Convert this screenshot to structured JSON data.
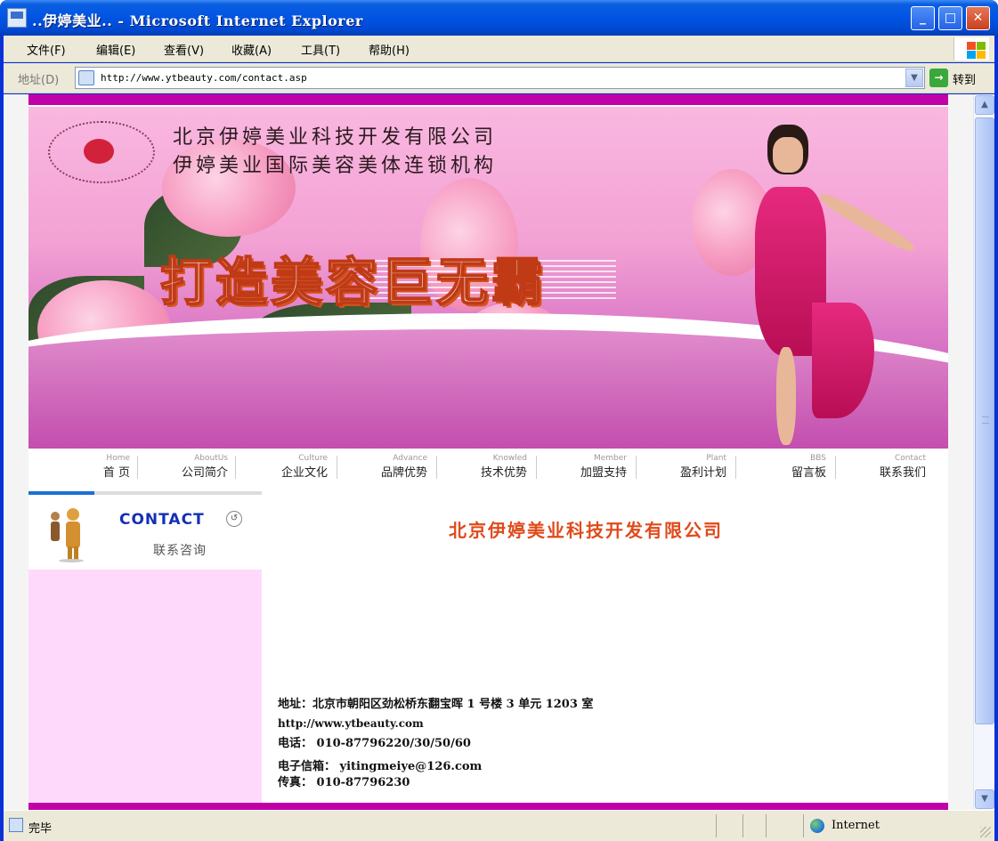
{
  "window": {
    "title": "..伊婷美业.. - Microsoft Internet Explorer"
  },
  "menubar": {
    "items": [
      "文件(F)",
      "编辑(E)",
      "查看(V)",
      "收藏(A)",
      "工具(T)",
      "帮助(H)"
    ]
  },
  "addressbar": {
    "label": "地址(D)",
    "url": "http://www.ytbeauty.com/contact.asp",
    "go_label": "转到"
  },
  "banner": {
    "company_name": "北京伊婷美业科技开发有限公司",
    "company_subtitle": "伊婷美业国际美容美体连锁机构",
    "slogan": "打造美容巨无霸"
  },
  "nav": {
    "items": [
      {
        "en": "Home",
        "cn": "首 页"
      },
      {
        "en": "AboutUs",
        "cn": "公司简介"
      },
      {
        "en": "Culture",
        "cn": "企业文化"
      },
      {
        "en": "Advance",
        "cn": "品牌优势"
      },
      {
        "en": "Knowled",
        "cn": "技术优势"
      },
      {
        "en": "Member",
        "cn": "加盟支持"
      },
      {
        "en": "Plant",
        "cn": "盈利计划"
      },
      {
        "en": "BBS",
        "cn": "留言板"
      },
      {
        "en": "Contact",
        "cn": "联系我们"
      }
    ]
  },
  "sidebar": {
    "title": "CONTACT",
    "subtitle": "联系咨询"
  },
  "main": {
    "title": "北京伊婷美业科技开发有限公司",
    "address": "地址：北京市朝阳区劲松桥东翻宝晖 1 号楼 3 单元 1203 室",
    "phone": "电话： 010-87796220/30/50/60",
    "fax": "传真： 010-87796230",
    "website": "http://www.ytbeauty.com",
    "email": "电子信箱： yitingmeiye@126.com"
  },
  "statusbar": {
    "text": "完毕",
    "zone": "Internet"
  },
  "colors": {
    "brand_magenta": "#c100a8",
    "title_red": "#e04a1a",
    "contact_blue": "#1530b5",
    "sidebar_pink": "#ffd9fb"
  }
}
